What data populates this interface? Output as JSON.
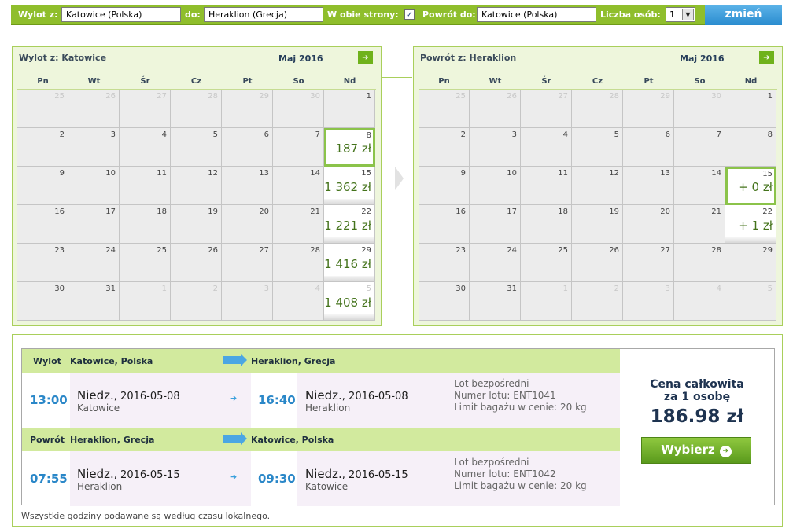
{
  "search": {
    "from_label": "Wylot z:",
    "from_value": "Katowice (Polska)",
    "to_label": "do:",
    "to_value": "Heraklion (Grecja)",
    "roundtrip_label": "W obie strony:",
    "roundtrip_checked": "✓",
    "return_label": "Powrót do:",
    "return_value": "Katowice (Polska)",
    "persons_label": "Liczba osób:",
    "persons_value": "1",
    "submit_label": "zmień",
    "accent": "#8fbe2c"
  },
  "weekdays": [
    "Pn",
    "Wt",
    "Śr",
    "Cz",
    "Pt",
    "So",
    "Nd"
  ],
  "outbound_calendar": {
    "title": "Wylot z: Katowice",
    "month": "Maj 2016",
    "next_icon": "arrow-right-icon",
    "weeks": [
      [
        {
          "d": "25",
          "dis": true
        },
        {
          "d": "26",
          "dis": true
        },
        {
          "d": "27",
          "dis": true
        },
        {
          "d": "28",
          "dis": true
        },
        {
          "d": "29",
          "dis": true
        },
        {
          "d": "30",
          "dis": true
        },
        {
          "d": "1"
        }
      ],
      [
        {
          "d": "2"
        },
        {
          "d": "3"
        },
        {
          "d": "4"
        },
        {
          "d": "5"
        },
        {
          "d": "6"
        },
        {
          "d": "7"
        },
        {
          "d": "8",
          "price": "187 zł",
          "sel": true
        }
      ],
      [
        {
          "d": "9"
        },
        {
          "d": "10"
        },
        {
          "d": "11"
        },
        {
          "d": "12"
        },
        {
          "d": "13"
        },
        {
          "d": "14"
        },
        {
          "d": "15",
          "price": "1 362 zł"
        }
      ],
      [
        {
          "d": "16"
        },
        {
          "d": "17"
        },
        {
          "d": "18"
        },
        {
          "d": "19"
        },
        {
          "d": "20"
        },
        {
          "d": "21"
        },
        {
          "d": "22",
          "price": "1 221 zł"
        }
      ],
      [
        {
          "d": "23"
        },
        {
          "d": "24"
        },
        {
          "d": "25"
        },
        {
          "d": "26"
        },
        {
          "d": "27"
        },
        {
          "d": "28"
        },
        {
          "d": "29",
          "price": "1 416 zł"
        }
      ],
      [
        {
          "d": "30"
        },
        {
          "d": "31"
        },
        {
          "d": "1",
          "dis": true
        },
        {
          "d": "2",
          "dis": true
        },
        {
          "d": "3",
          "dis": true
        },
        {
          "d": "4",
          "dis": true
        },
        {
          "d": "5",
          "price": "1 408 zł",
          "dis": true
        }
      ]
    ]
  },
  "return_calendar": {
    "title": "Powrót z: Heraklion",
    "month": "Maj 2016",
    "next_icon": "arrow-right-icon",
    "weeks": [
      [
        {
          "d": "25",
          "dis": true
        },
        {
          "d": "26",
          "dis": true
        },
        {
          "d": "27",
          "dis": true
        },
        {
          "d": "28",
          "dis": true
        },
        {
          "d": "29",
          "dis": true
        },
        {
          "d": "30",
          "dis": true
        },
        {
          "d": "1"
        }
      ],
      [
        {
          "d": "2"
        },
        {
          "d": "3"
        },
        {
          "d": "4"
        },
        {
          "d": "5"
        },
        {
          "d": "6"
        },
        {
          "d": "7"
        },
        {
          "d": "8"
        }
      ],
      [
        {
          "d": "9"
        },
        {
          "d": "10"
        },
        {
          "d": "11"
        },
        {
          "d": "12"
        },
        {
          "d": "13"
        },
        {
          "d": "14"
        },
        {
          "d": "15",
          "price": "+ 0 zł",
          "sel": true
        }
      ],
      [
        {
          "d": "16"
        },
        {
          "d": "17"
        },
        {
          "d": "18"
        },
        {
          "d": "19"
        },
        {
          "d": "20"
        },
        {
          "d": "21"
        },
        {
          "d": "22",
          "price": "+ 1 zł"
        }
      ],
      [
        {
          "d": "23"
        },
        {
          "d": "24"
        },
        {
          "d": "25"
        },
        {
          "d": "26"
        },
        {
          "d": "27"
        },
        {
          "d": "28"
        },
        {
          "d": "29"
        }
      ],
      [
        {
          "d": "30"
        },
        {
          "d": "31"
        },
        {
          "d": "1",
          "dis": true
        },
        {
          "d": "2",
          "dis": true
        },
        {
          "d": "3",
          "dis": true
        },
        {
          "d": "4",
          "dis": true
        },
        {
          "d": "5",
          "dis": true
        }
      ]
    ]
  },
  "outbound": {
    "label": "Wylot",
    "from": "Katowice, Polska",
    "to": "Heraklion, Grecja",
    "dep_time": "13:00",
    "dep_day": "Niedz.",
    "dep_date": ", 2016-05-08",
    "dep_city": "Katowice",
    "arr_time": "16:40",
    "arr_day": "Niedz.",
    "arr_date": ", 2016-05-08",
    "arr_city": "Heraklion",
    "info1": "Lot bezpośredni",
    "info2": "Numer lotu: ENT1041",
    "info3": "Limit bagażu w cenie: 20 kg"
  },
  "inbound": {
    "label": "Powrót",
    "from": "Heraklion, Grecja",
    "to": "Katowice, Polska",
    "dep_time": "07:55",
    "dep_day": "Niedz.",
    "dep_date": ", 2016-05-15",
    "dep_city": "Heraklion",
    "arr_time": "09:30",
    "arr_day": "Niedz.",
    "arr_date": ", 2016-05-15",
    "arr_city": "Katowice",
    "info1": "Lot bezpośredni",
    "info2": "Numer lotu: ENT1042",
    "info3": "Limit bagażu w cenie: 20 kg"
  },
  "price": {
    "label_line1": "Cena całkowita",
    "label_line2": "za 1 osobę",
    "amount": "186.98 zł",
    "choose_label": "Wybierz"
  },
  "footnote": "Wszystkie godziny podawane są według czasu lokalnego."
}
